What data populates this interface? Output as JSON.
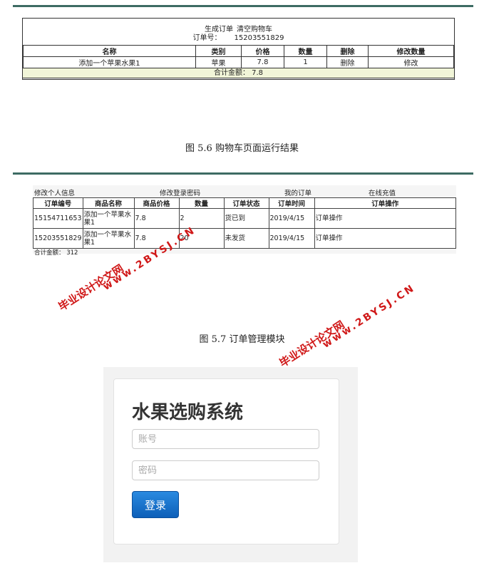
{
  "cart": {
    "links": [
      "生成订单",
      "清空购物车"
    ],
    "order_label": "订单号：",
    "order_no": "15203551829",
    "columns": [
      "名称",
      "类别",
      "价格",
      "数量",
      "删除",
      "修改数量"
    ],
    "row": [
      "添加一个苹果水果1",
      "苹果",
      "7.8",
      "1",
      "删除",
      "修改"
    ],
    "total_label": "合计金额：",
    "total": "7.8"
  },
  "caption1": "图  5.6 购物车页面运行结果",
  "orders": {
    "nav": [
      "修改个人信息",
      "修改登录密码",
      "我的订单",
      "在线充值"
    ],
    "columns": [
      "订单编号",
      "商品名称",
      "商品价格",
      "数量",
      "订单状态",
      "订单时间",
      "订单操作"
    ],
    "rows": [
      [
        "15154711653",
        "添加一个苹果水果1",
        "7.8",
        "2",
        "货已到",
        "2019/4/15",
        "订单操作"
      ],
      [
        "15203551829",
        "添加一个苹果水果1",
        "7.8",
        "20",
        "未发货",
        "2019/4/15",
        "订单操作"
      ]
    ],
    "sum": "合计金额： 312"
  },
  "caption2": "图  5.7  订单管理模块",
  "watermark": {
    "line1": "毕业设计论文网",
    "line2": "www.2BYSJ.CN"
  },
  "login": {
    "title": "水果选购系统",
    "account_placeholder": "账号",
    "password_placeholder": "密码",
    "button": "登录"
  }
}
